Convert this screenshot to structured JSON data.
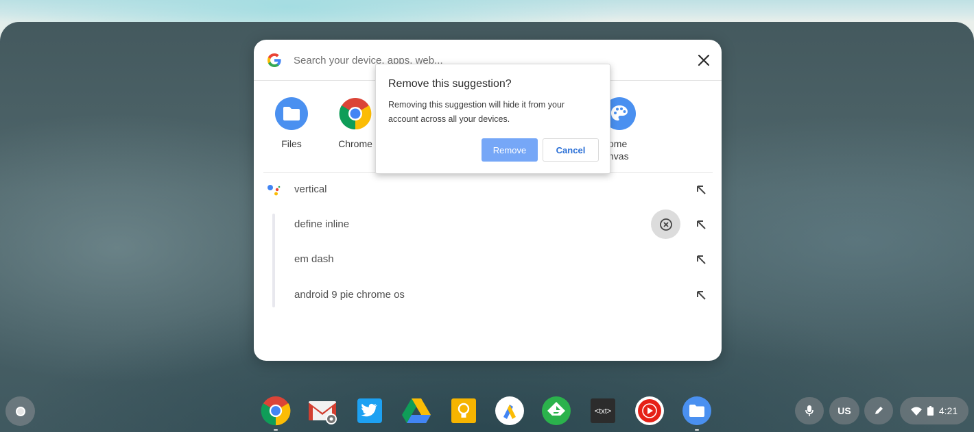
{
  "search": {
    "placeholder": "Search your device, apps, web..."
  },
  "apps": [
    {
      "label": "Files",
      "icon": "files-icon"
    },
    {
      "label": "Chrome",
      "icon": "chrome-icon"
    },
    {
      "label": "ome\nnvas",
      "icon": "canvas-icon"
    }
  ],
  "apps_partial_label_line1": "ome",
  "apps_partial_label_line2": "nvas",
  "results": [
    {
      "text": "vertical",
      "icon": "assistant-icon"
    },
    {
      "text": "define inline"
    },
    {
      "text": "em dash"
    },
    {
      "text": "android 9 pie chrome os"
    }
  ],
  "dialog": {
    "title": "Remove this suggestion?",
    "body": "Removing this suggestion will hide it from your account across all your devices.",
    "remove_label": "Remove",
    "cancel_label": "Cancel"
  },
  "shelf": {
    "apps": [
      "chrome-icon",
      "gmail-icon",
      "twitter-icon",
      "drive-icon",
      "keep-icon",
      "adsense-icon",
      "feedly-icon",
      "text-editor-icon",
      "youtube-music-icon",
      "files-icon"
    ]
  },
  "tray": {
    "keyboard": "US",
    "time": "4:21"
  },
  "colors": {
    "accent": "#4285f4",
    "dialog_primary": "#76a7f7",
    "cancel_text": "#2a6fd6"
  }
}
